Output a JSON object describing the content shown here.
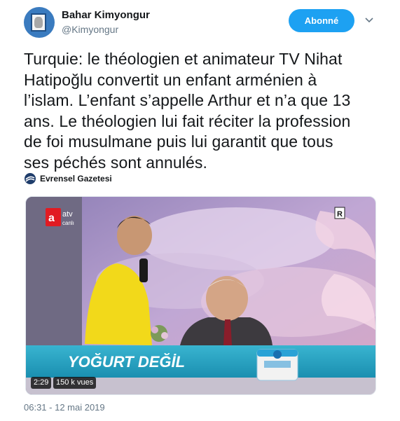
{
  "author": {
    "name": "Bahar Kimyongur",
    "handle": "@Kimyongur",
    "follow_label": "Abonné"
  },
  "tweet": {
    "lines": [
      "Turquie: le théologien et animateur TV Nihat",
      "Hatipoğlu convertit un enfant arménien à",
      "l’islam. L’enfant s’appelle Arthur et n’a que 13",
      "ans. Le théologien lui fait réciter la profession",
      "de foi musulmane puis lui garantit que tous",
      "ses péchés sont annulés."
    ]
  },
  "source": {
    "label": "Evrensel Gazetesi",
    "icon": "evrensel-logo-icon"
  },
  "video": {
    "channel_logo": "atv",
    "channel_sub": "canlı",
    "rating": "R",
    "banner_text": "YOĞURT DEĞİL",
    "duration": "2:29",
    "views": "150 k vues"
  },
  "timestamp": "06:31 - 12 mai 2019",
  "colors": {
    "accent": "#1da1f2",
    "text": "#14171a",
    "muted": "#657786"
  }
}
